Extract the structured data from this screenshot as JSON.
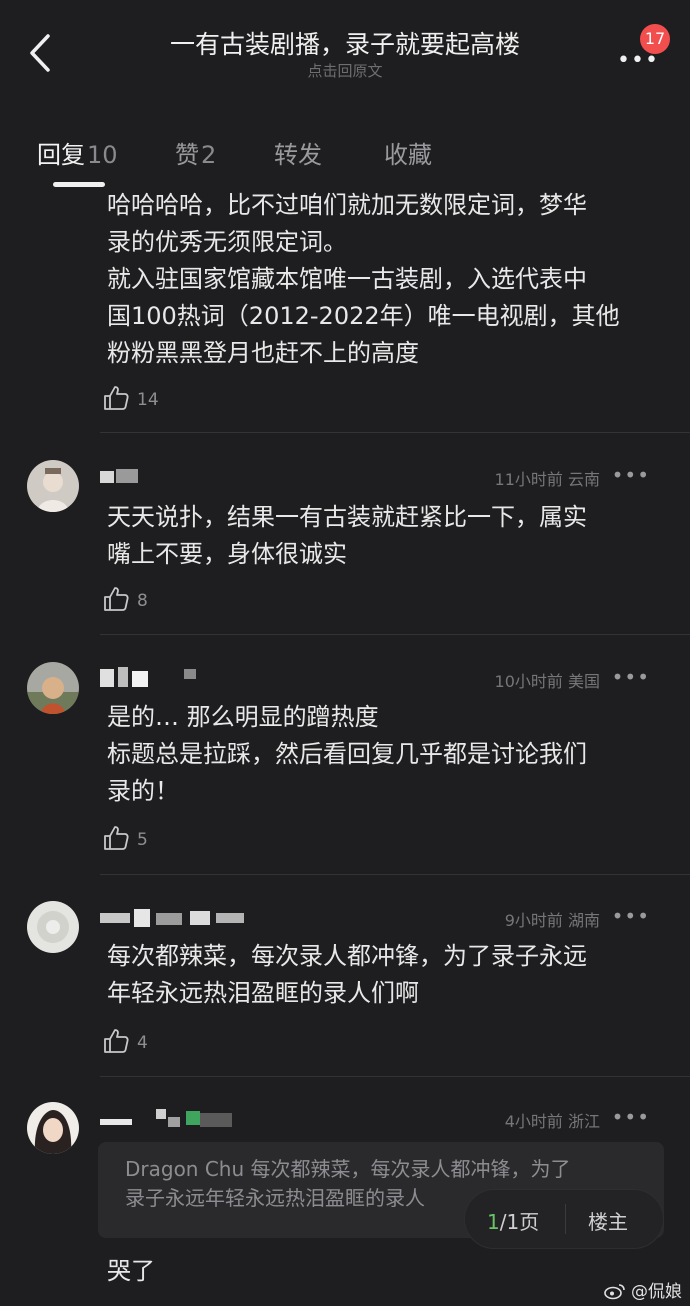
{
  "header": {
    "title": "一有古装剧播，录子就要起高楼",
    "subtitle": "点击回原文",
    "badge_count": "17"
  },
  "tabs": [
    {
      "label": "回复",
      "count": "10",
      "active": true
    },
    {
      "label": "赞",
      "count": "2",
      "active": false
    },
    {
      "label": "转发",
      "count": "",
      "active": false
    },
    {
      "label": "收藏",
      "count": "",
      "active": false
    }
  ],
  "comments": [
    {
      "text_lines": [
        "哈哈哈哈，比不过咱们就加无数限定词，梦华",
        "录的优秀无须限定词。",
        "就入驻国家馆藏本馆唯一古装剧，入选代表中",
        "国100热词（2012-2022年）唯一电视剧，其他",
        "粉粉黑黑登月也赶不上的高度"
      ],
      "likes": "14"
    },
    {
      "time": "11小时前",
      "location": "云南",
      "text_lines": [
        "天天说扑，结果一有古装就赶紧比一下，属实",
        "嘴上不要，身体很诚实"
      ],
      "likes": "8"
    },
    {
      "time": "10小时前",
      "location": "美国",
      "text_lines": [
        "是的… 那么明显的蹭热度",
        "标题总是拉踩，然后看回复几乎都是讨论我们",
        "录的！"
      ],
      "likes": "5"
    },
    {
      "time": "9小时前",
      "location": "湖南",
      "text_lines": [
        "每次都辣菜，每次录人都冲锋，为了录子永远",
        "年轻永远热泪盈眶的录人们啊"
      ],
      "likes": "4"
    },
    {
      "time": "4小时前",
      "location": "浙江",
      "quote_lines": [
        "Dragon Chu 每次都辣菜，每次录人都冲锋，为了",
        "录子永远年轻永远热泪盈眶的录人"
      ],
      "text_lines": [
        "哭了"
      ]
    }
  ],
  "pager": {
    "current": "1",
    "total_text": "/1页",
    "op_label": "楼主"
  },
  "watermark": "@侃娘",
  "colors": {
    "background": "#1e1e20",
    "badge": "#f24e4e",
    "pager_current": "#68c466"
  }
}
